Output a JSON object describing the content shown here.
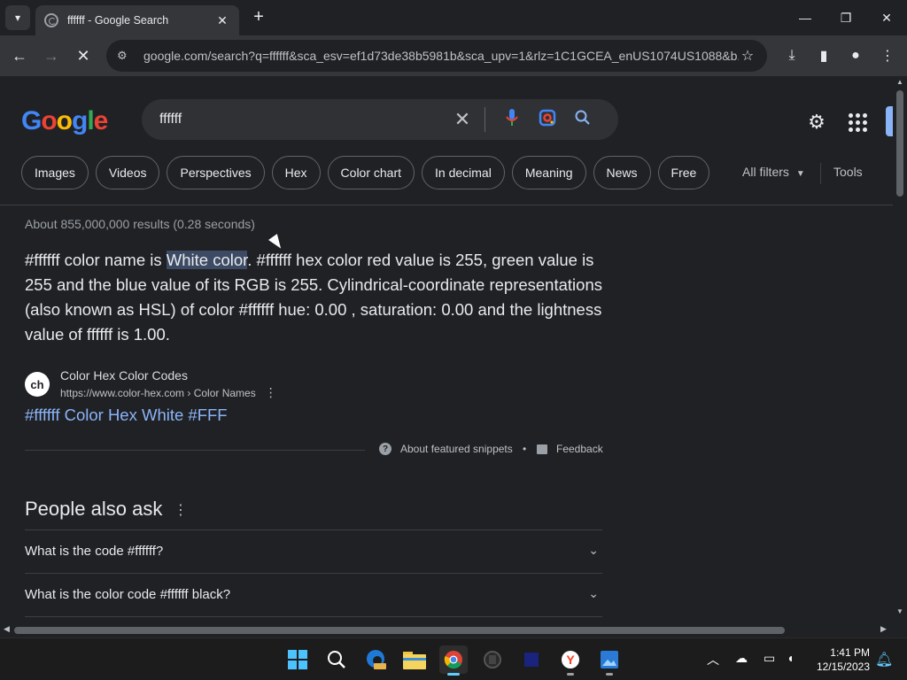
{
  "browser": {
    "tab_title": "ffffff - Google Search",
    "url": "google.com/search?q=ffffff&sca_esv=ef1d73de38b5981b&sca_upv=1&rlz=1C1GCEA_enUS1074US1088&b..."
  },
  "search": {
    "logo_letters": [
      "G",
      "o",
      "o",
      "g",
      "l",
      "e"
    ],
    "logo_colors": [
      "#4285f4",
      "#ea4335",
      "#fbbc05",
      "#4285f4",
      "#34a853",
      "#ea4335"
    ],
    "query": "ffffff",
    "chips": [
      "Images",
      "Videos",
      "Perspectives",
      "Hex",
      "Color chart",
      "In decimal",
      "Meaning",
      "News",
      "Free"
    ],
    "all_filters": "All filters",
    "tools": "Tools",
    "stats": "About 855,000,000 results (0.28 seconds)"
  },
  "snippet": {
    "pre": "#ffffff color name is ",
    "highlight": "White color",
    "post": ". #ffffff hex color red value is 255, green value is 255 and the blue value of its RGB is 255. Cylindrical-coordinate representations (also known as HSL) of color #ffffff hue: 0.00 , saturation: 0.00 and the lightness value of ffffff is 1.00.",
    "source_favicon": "ch",
    "source_name": "Color Hex Color Codes",
    "source_cite": "https://www.color-hex.com › Color Names",
    "result_link": "#ffffff Color Hex White #FFF",
    "about_snippets": "About featured snippets",
    "separator": "•",
    "feedback": "Feedback"
  },
  "paa": {
    "title": "People also ask",
    "questions": [
      "What is the code #ffffff?",
      "What is the color code #ffffff black?"
    ]
  },
  "taskbar": {
    "time": "1:41 PM",
    "date": "12/15/2023"
  }
}
